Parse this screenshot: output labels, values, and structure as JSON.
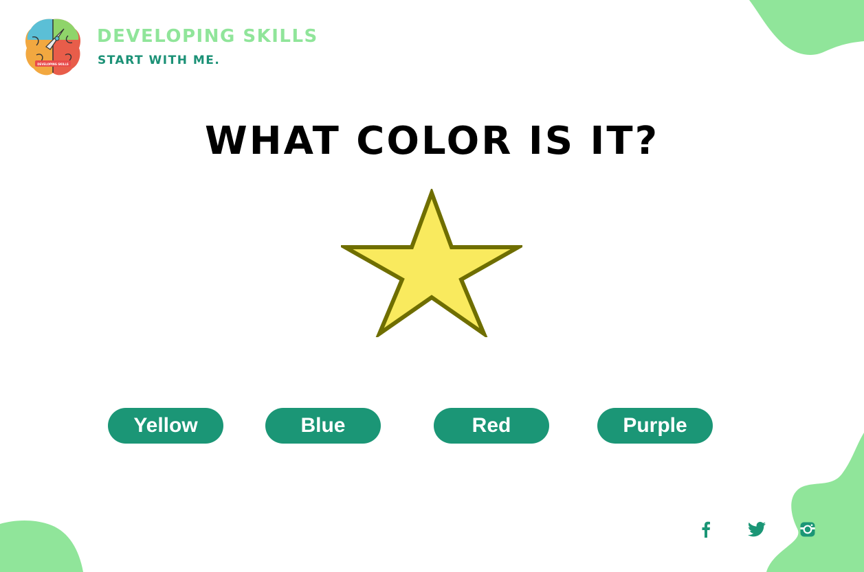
{
  "brand": {
    "title": "Developing Skills",
    "tagline": "Start with me.",
    "logo_text": "DEVELOPING SKILLS"
  },
  "question": "What color is it?",
  "shape": {
    "name": "star-icon",
    "fill": "#f9ea5e",
    "stroke": "#6f6e00"
  },
  "options": [
    "Yellow",
    "Blue",
    "Red",
    "Purple"
  ],
  "social": [
    "facebook-icon",
    "twitter-icon",
    "instagram-icon"
  ],
  "colors": {
    "accent": "#1b9676",
    "brand_light": "#90e59a",
    "blob": "#90e59a"
  }
}
